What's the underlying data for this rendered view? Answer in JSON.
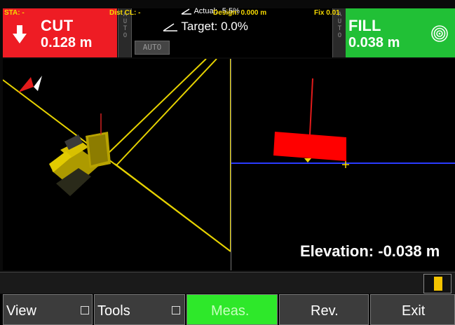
{
  "top_bar": {
    "cut": {
      "label": "CUT",
      "value": "0.128 m",
      "color": "#ee1c24",
      "icon": "down-arrow-icon"
    },
    "auto_strip_left": "AUTO",
    "auto_badge": "AUTO",
    "actual": "Actual: -5.5%",
    "target": "Target: 0.0%",
    "auto_strip_right": "AUTO",
    "fill": {
      "label": "FILL",
      "value": "0.038 m",
      "color": "#21c036",
      "icon": "gps-signal-icon"
    }
  },
  "right_view": {
    "elevation": "Elevation: -0.038 m"
  },
  "info_row": {
    "sta": "STA: -",
    "dist_cl": "Dist CL: -",
    "design": "Design: 0.000 m",
    "fix": "Fix 0.01"
  },
  "buttons": {
    "view": "View",
    "tools": "Tools",
    "meas": "Meas.",
    "rev": "Rev.",
    "exit": "Exit"
  },
  "colors": {
    "accent_yellow": "#f5d800",
    "blade_red": "#ff0000",
    "grade_line_blue": "#2b3bff",
    "active_button": "#2ee82a"
  }
}
